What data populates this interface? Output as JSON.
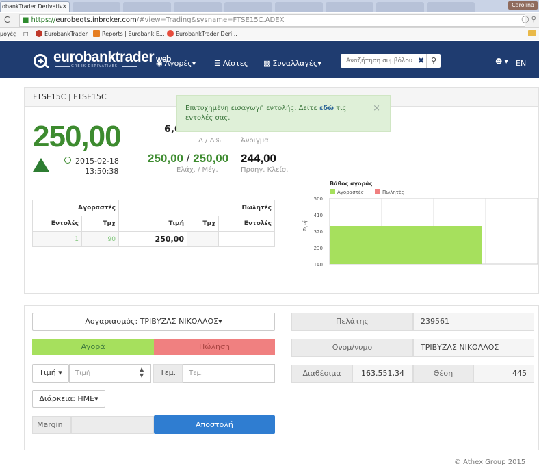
{
  "browser": {
    "tab_title": "obankTrader Derivativ",
    "tab_close": "×",
    "user_badge": "Carolina",
    "url_https": "https://",
    "url_host": "eurobeqts.inbroker.com",
    "url_rest": "/#view=Trading&sysname=FTSE15C.ADEX",
    "bookmarks": [
      "μογές",
      "EurobankTrader",
      "Reports | Eurobank E...",
      "EurobankTrader Deri..."
    ]
  },
  "nav": {
    "logo": "eurobanktrader",
    "logo_web": "web",
    "logo_sub": "GREEK DERIVATIVES",
    "markets": "Αγορές",
    "lists": "Λίστες",
    "transactions": "Συναλλαγές",
    "search_placeholder": "Αναζήτηση συμβόλου",
    "lang": "EN"
  },
  "instrument": {
    "title": "FTSE15C | FTSE15C",
    "last_price": "250,00",
    "date": "2015-02-18",
    "time": "13:50:38",
    "change": "6,0",
    "change_label": "Δ / Δ%",
    "open_label": "Άνοιγμα",
    "low": "250,00",
    "slash": "/",
    "high": "250,00",
    "lowhigh_label": "Ελάχ. / Μέγ.",
    "prev_close": "244,00",
    "prev_close_label": "Προηγ. Κλείσ."
  },
  "alert": {
    "text_before": "Επιτυχημένη εισαγωγή εντολής. Δείτε ",
    "link": "εδώ",
    "text_after": " τις εντολές σας.",
    "close": "×"
  },
  "depth": {
    "buyers": "Αγοραστές",
    "sellers": "Πωλητές",
    "orders": "Εντολές",
    "qty": "Τμχ",
    "price": "Τιμή",
    "rows": [
      {
        "buy_orders": "1",
        "buy_qty": "90",
        "price": "250,00",
        "sell_qty": "",
        "sell_orders": ""
      }
    ]
  },
  "chart_data": {
    "type": "bar",
    "title": "Βάθος αγοράς",
    "ylabel": "Τιμή",
    "ylim": [
      140,
      500
    ],
    "yticks": [
      140,
      230,
      320,
      410,
      500
    ],
    "series": [
      {
        "name": "Αγοραστές",
        "color": "#a6e05d",
        "values": [
          350
        ]
      },
      {
        "name": "Πωλητές",
        "color": "#f08080",
        "values": []
      }
    ]
  },
  "order": {
    "account": "Λογαριασμός: ΤΡΙΒΥΖΑΣ ΝΙΚΟΛΑΟΣ",
    "buy": "Αγορά",
    "sell": "Πώληση",
    "price_type": "Τιμή",
    "price_placeholder": "Τιμή",
    "qty_label": "Τεμ.",
    "qty_placeholder": "Τεμ.",
    "duration": "Διάρκεια: ΗΜΕ",
    "margin": "Margin",
    "send": "Αποστολή"
  },
  "client": {
    "client_label": "Πελάτης",
    "client_value": "239561",
    "name_label": "Ονομ/νυμο",
    "name_value": "ΤΡΙΒΥΖΑΣ ΝΙΚΟΛΑΟΣ",
    "available_label": "Διαθέσιμα",
    "available_value": "163.551,34",
    "position_label": "Θέση",
    "position_value": "445"
  },
  "footer": "© Athex Group 2015"
}
